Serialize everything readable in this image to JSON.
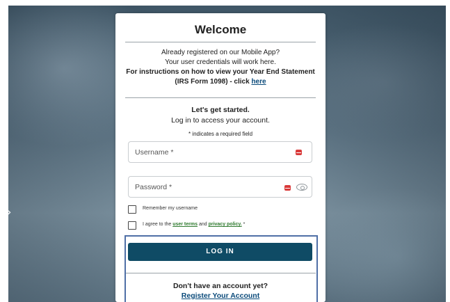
{
  "card": {
    "title": "Welcome",
    "info_line1": "Already registered on our Mobile App?",
    "info_line2": "Your user credentials will work here.",
    "info_bold": "For instructions on how to view your Year End Statement (IRS Form 1098) - click ",
    "info_link": "here"
  },
  "login": {
    "heading": "Let's get started.",
    "subheading": "Log in to access your account.",
    "required_note": "* indicates a required field",
    "username_label": "Username *",
    "password_label": "Password *",
    "remember_label": "Remember my username",
    "agree_prefix": "I agree to the ",
    "user_terms": "user terms",
    "agree_and": " and ",
    "privacy_policy": "privacy policy.",
    "agree_suffix": " *",
    "button_label": "LOG IN"
  },
  "register": {
    "prompt": "Don't have an account yet?",
    "link": "Register Your Account"
  },
  "icons": {
    "carousel_prev": "chevron-right-icon",
    "field_error": "error-icon",
    "password_toggle": "eye-icon"
  },
  "colors": {
    "primary_button": "#0f4b65",
    "link": "#0a4a7a",
    "terms_link": "#2f7a2f",
    "error": "#d93a3a",
    "highlight_border": "#4f6fa6"
  }
}
